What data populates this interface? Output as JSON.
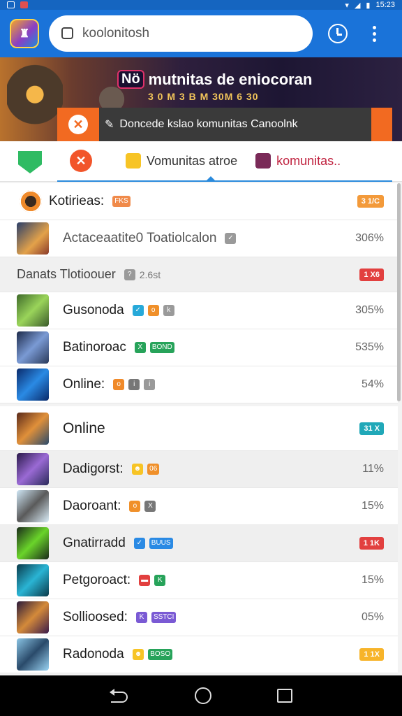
{
  "status_bar": {
    "time": "15:23"
  },
  "search": {
    "value": "koolonitosh"
  },
  "banner": {
    "badge": "Nö",
    "title": "mutnitas de eniocoran",
    "subtitle": "3 0 M 3 B M 30M 6 30"
  },
  "notification": {
    "text": "Doncede kslao komunitas Canoolnk"
  },
  "tabs": [
    {
      "label": "Vomunitas atroe"
    },
    {
      "label": "komunitas.."
    }
  ],
  "rows": [
    {
      "label": "Kotirieas:",
      "chips": [
        {
          "text": "FKS",
          "color": "#f08a4a"
        }
      ],
      "badge": "3 1/C",
      "badge_color": "#f39a3a",
      "kind": "header"
    },
    {
      "label": "Actaceaatite0 Toatiolcalon",
      "chips": [
        {
          "text": "✓",
          "color": "#9a9a9a"
        }
      ],
      "pct": "306%",
      "kind": "item",
      "thumb": "linear-gradient(135deg,#2a3f6a,#e3a24a 60%,#8a3a2a)"
    },
    {
      "label": "Danats Tlotioouer",
      "chips": [
        {
          "text": "?",
          "color": "#9a9a9a"
        }
      ],
      "extra": "2.6st",
      "badge": "1 X6",
      "badge_color": "#e2403f",
      "kind": "section"
    },
    {
      "label": "Gusonoda",
      "chips": [
        {
          "text": "✓",
          "color": "#27a9d9"
        },
        {
          "text": "o",
          "color": "#f0902a"
        },
        {
          "text": "k",
          "color": "#9a9a9a"
        }
      ],
      "pct": "305%",
      "kind": "item",
      "thumb": "linear-gradient(135deg,#3f6a2a,#9ad45a 50%,#3a5a2a)"
    },
    {
      "label": "Batinoroac",
      "chips": [
        {
          "text": "X",
          "color": "#27a35a"
        },
        {
          "text": "BOND",
          "color": "#27a35a"
        }
      ],
      "pct": "535%",
      "kind": "item",
      "thumb": "linear-gradient(135deg,#1d2a4a,#7a9ad4 50%,#2a3a5a)"
    },
    {
      "label": "Online:",
      "chips": [
        {
          "text": "o",
          "color": "#f08a2a"
        },
        {
          "text": "i",
          "color": "#777"
        },
        {
          "text": "i",
          "color": "#9a9a9a"
        }
      ],
      "pct": "54%",
      "kind": "item",
      "thumb": "linear-gradient(135deg,#0a2a6a,#2a8ae4 50%,#0a2a6a)"
    },
    {
      "label": "Online",
      "chips": [],
      "badge": "31 X",
      "badge_color": "#20a8b8",
      "kind": "tall",
      "thumb": "linear-gradient(135deg,#5a2a1a,#e0903a 50%,#2a4a6a)"
    },
    {
      "label": "Dadigorst:",
      "chips": [
        {
          "text": "☻",
          "color": "#f7c425"
        },
        {
          "text": "06",
          "color": "#f0902a"
        }
      ],
      "pct": "11%",
      "kind": "item grey",
      "thumb": "linear-gradient(135deg,#2a1a4a,#9a6ad4 50%,#2a2a5a)"
    },
    {
      "label": "Daoroant:",
      "chips": [
        {
          "text": "o",
          "color": "#f0902a"
        },
        {
          "text": "X",
          "color": "#777"
        }
      ],
      "pct": "15%",
      "kind": "item",
      "thumb": "linear-gradient(135deg,#cfe6f5,#5a5a5a 50%,#dbeef9)"
    },
    {
      "label": "Gnatirradd",
      "chips": [
        {
          "text": "✓",
          "color": "#2a8ae4"
        },
        {
          "text": "BUUS",
          "color": "#2a8ae4"
        }
      ],
      "badge": "1 1K",
      "badge_color": "#e2403f",
      "kind": "item grey",
      "thumb": "linear-gradient(135deg,#1a2a1a,#6ad42a 50%,#1a2a1a)"
    },
    {
      "label": "Petgoroact:",
      "chips": [
        {
          "text": "▬",
          "color": "#e2403f"
        },
        {
          "text": "K",
          "color": "#27a35a"
        }
      ],
      "pct": "15%",
      "kind": "item",
      "thumb": "linear-gradient(135deg,#0a3a4a,#2ab4d4 50%,#0a3a4a)"
    },
    {
      "label": "Sollioosed:",
      "chips": [
        {
          "text": "K",
          "color": "#7a5ad4"
        },
        {
          "text": "SSTCI",
          "color": "#7a5ad4"
        }
      ],
      "pct": "05%",
      "kind": "item",
      "thumb": "linear-gradient(135deg,#2a1a3a,#d48a3a 50%,#3a1a4a)"
    },
    {
      "label": "Radonoda",
      "chips": [
        {
          "text": "☻",
          "color": "#f7c425"
        },
        {
          "text": "BOSO",
          "color": "#27a35a"
        }
      ],
      "badge": "1 1X",
      "badge_color": "#f7b42a",
      "kind": "item",
      "thumb": "linear-gradient(135deg,#8ac4e4,#2a4a6a 50%,#9ad4f4)"
    }
  ],
  "colors": {
    "primary": "#1a73d9",
    "accent": "#f26a21"
  }
}
